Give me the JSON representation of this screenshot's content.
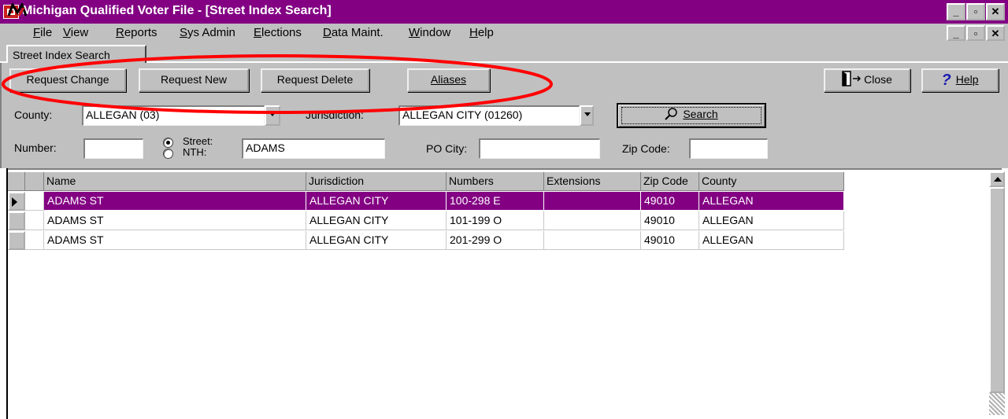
{
  "window": {
    "title": "Michigan Qualified Voter File - [Street Index Search]",
    "controls": [
      "_",
      "▫",
      "✕"
    ]
  },
  "menu": [
    {
      "underline": "F",
      "rest": "ile"
    },
    {
      "underline": "V",
      "rest": "iew"
    },
    {
      "underline": "R",
      "rest": "eports"
    },
    {
      "underline": "S",
      "rest": "ys Admin"
    },
    {
      "underline": "E",
      "rest": "lections"
    },
    {
      "underline": "D",
      "rest": "ata Maint."
    },
    {
      "underline": "W",
      "rest": "indow"
    },
    {
      "underline": "H",
      "rest": "elp"
    }
  ],
  "tabs": [
    "Street Index Search"
  ],
  "toolbar": {
    "request_change": "Request Change",
    "request_new": "Request New",
    "request_delete": "Request Delete",
    "aliases": "Aliases",
    "close": "Close",
    "help": "Help"
  },
  "search": {
    "county_label": "County:",
    "county_value": "ALLEGAN (03)",
    "jurisdiction_label": "Jurisdiction:",
    "jurisdiction_value": "ALLEGAN CITY (01260)",
    "search_button": "Search",
    "number_label": "Number:",
    "number_value": "",
    "street_label": "Street:",
    "nth_label": "NTH:",
    "street_value": "ADAMS",
    "po_city_label": "PO City:",
    "po_city_value": "",
    "zip_label": "Zip Code:",
    "zip_value": ""
  },
  "grid": {
    "columns": [
      "Name",
      "Jurisdiction",
      "Numbers",
      "Extensions",
      "Zip Code",
      "County"
    ],
    "rows": [
      [
        "ADAMS ST",
        "ALLEGAN CITY",
        "100-298 E",
        "",
        "49010",
        "ALLEGAN"
      ],
      [
        "ADAMS ST",
        "ALLEGAN CITY",
        "101-199 O",
        "",
        "49010",
        "ALLEGAN"
      ],
      [
        "ADAMS ST",
        "ALLEGAN CITY",
        "201-299 O",
        "",
        "49010",
        "ALLEGAN"
      ]
    ],
    "selected_row": 0
  },
  "colors": {
    "title_bar": "#830083",
    "selected_row": "#830083",
    "annotation_circle": "#ff0000"
  }
}
